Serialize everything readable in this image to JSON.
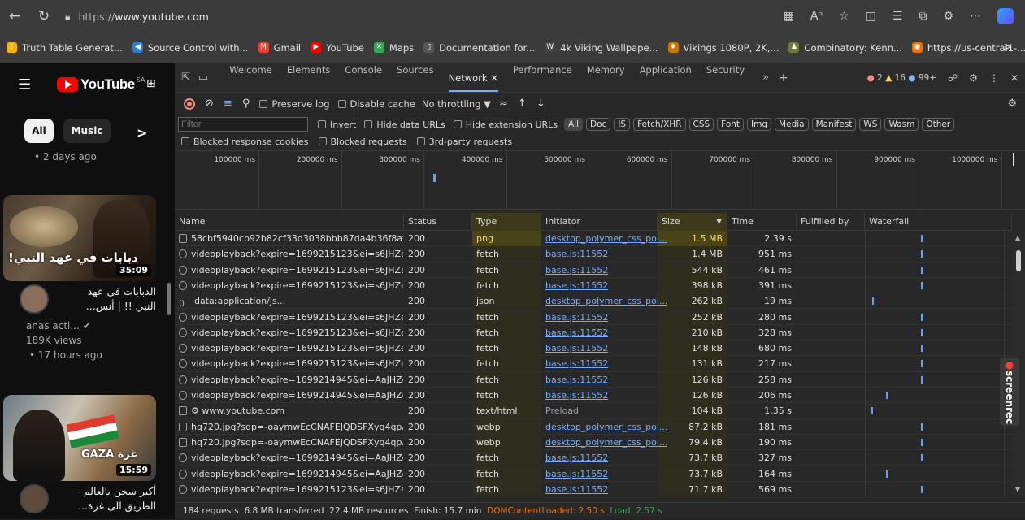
{
  "browser": {
    "url_prefix": "https://",
    "url_host": "www.youtube.com",
    "bookmarks": [
      {
        "label": "Truth Table Generat...",
        "color": "#f4b400",
        "glyph": "!"
      },
      {
        "label": "Source Control with...",
        "color": "#2f7cd6",
        "glyph": "◀"
      },
      {
        "label": "Gmail",
        "color": "#ea4335",
        "glyph": "M"
      },
      {
        "label": "YouTube",
        "color": "#ff0000",
        "glyph": "▶"
      },
      {
        "label": "Maps",
        "color": "#34a853",
        "glyph": "✕"
      },
      {
        "label": "Documentation for...",
        "color": "#555555",
        "glyph": "▯"
      },
      {
        "label": "4k Viking Wallpape...",
        "color": "#444444",
        "glyph": "W"
      },
      {
        "label": "Vikings 1080P, 2K,...",
        "color": "#c77700",
        "glyph": "♦"
      },
      {
        "label": "Combinatory: Kenn...",
        "color": "#6b7b3a",
        "glyph": "♟"
      },
      {
        "label": "https://us-central1-...",
        "color": "#e8710a",
        "glyph": "◉"
      }
    ],
    "bookmarks_more": ">"
  },
  "youtube": {
    "logo": "YouTube",
    "region": "SA",
    "chips": {
      "all": "All",
      "music": "Music",
      "next": ">"
    },
    "meta_top": "• 2 days ago",
    "video1": {
      "duration": "35:09",
      "title_line1": "الدبابات في عهد",
      "title_line2": "النبي !! | أنس...",
      "channel": "anas acti...",
      "views": "189K views",
      "age": "• 17 hours ago",
      "thumb_text": "دبابات في عهد النبي!"
    },
    "video2": {
      "duration": "15:59",
      "title_line1": "أكبر سجن بالعالم -",
      "title_line2": "الطريق الى غزة...",
      "thumb_text": "GAZA غزة"
    }
  },
  "devtools": {
    "tabs": [
      "Welcome",
      "Elements",
      "Console",
      "Sources",
      "Network",
      "Performance",
      "Memory",
      "Application",
      "Security"
    ],
    "active_tab": "Network",
    "badges": {
      "errors": "2",
      "warnings": "16",
      "info": "99+"
    },
    "toolbar": {
      "preserve_log": "Preserve log",
      "disable_cache": "Disable cache",
      "throttling": "No throttling"
    },
    "filter": {
      "placeholder": "Filter",
      "invert": "Invert",
      "hide_data_urls": "Hide data URLs",
      "hide_extension_urls": "Hide extension URLs",
      "types": [
        "All",
        "Doc",
        "JS",
        "Fetch/XHR",
        "CSS",
        "Font",
        "Img",
        "Media",
        "Manifest",
        "WS",
        "Wasm",
        "Other"
      ],
      "blocked_cookies": "Blocked response cookies",
      "blocked_requests": "Blocked requests",
      "third_party": "3rd-party requests"
    },
    "timeline_ticks": [
      "100000 ms",
      "200000 ms",
      "300000 ms",
      "400000 ms",
      "500000 ms",
      "600000 ms",
      "700000 ms",
      "800000 ms",
      "900000 ms",
      "1000000 ms"
    ],
    "columns": {
      "name": "Name",
      "status": "Status",
      "type": "Type",
      "initiator": "Initiator",
      "size": "Size",
      "time": "Time",
      "fulfilled": "Fulfilled by",
      "waterfall": "Waterfall"
    },
    "rows": [
      {
        "name": "58cbf5940cb92b82cf33d3038bbb87da4b36f8af52c...",
        "status": "200",
        "type": "png",
        "initiator": "desktop_polymer_css_pol...",
        "init_link": true,
        "size": "1.5 MB",
        "time": "2.39 s",
        "icon": "doc",
        "wf": 0.38
      },
      {
        "name": "videoplayback?expire=1699215123&ei=s6JHZe-AB...",
        "status": "200",
        "type": "fetch",
        "initiator": "base.js:11552",
        "init_link": true,
        "size": "1.4 MB",
        "time": "951 ms",
        "icon": "fetch",
        "wf": 0.38
      },
      {
        "name": "videoplayback?expire=1699215123&ei=s6JHZe-AB...",
        "status": "200",
        "type": "fetch",
        "initiator": "base.js:11552",
        "init_link": true,
        "size": "544 kB",
        "time": "461 ms",
        "icon": "fetch",
        "wf": 0.38
      },
      {
        "name": "videoplayback?expire=1699215123&ei=s6JHZe-AB...",
        "status": "200",
        "type": "fetch",
        "initiator": "base.js:11552",
        "init_link": true,
        "size": "398 kB",
        "time": "391 ms",
        "icon": "fetch",
        "wf": 0.38
      },
      {
        "name": "data:application/js...",
        "status": "200",
        "type": "json",
        "initiator": "desktop_polymer_css_pol...",
        "init_link": true,
        "size": "262 kB",
        "time": "19 ms",
        "icon": "data",
        "wf": 0.02
      },
      {
        "name": "videoplayback?expire=1699215123&ei=s6JHZe-AB...",
        "status": "200",
        "type": "fetch",
        "initiator": "base.js:11552",
        "init_link": true,
        "size": "252 kB",
        "time": "280 ms",
        "icon": "fetch",
        "wf": 0.38
      },
      {
        "name": "videoplayback?expire=1699215123&ei=s6JHZe-AB...",
        "status": "200",
        "type": "fetch",
        "initiator": "base.js:11552",
        "init_link": true,
        "size": "210 kB",
        "time": "328 ms",
        "icon": "fetch",
        "wf": 0.38
      },
      {
        "name": "videoplayback?expire=1699215123&ei=s6JHZe-AB...",
        "status": "200",
        "type": "fetch",
        "initiator": "base.js:11552",
        "init_link": true,
        "size": "148 kB",
        "time": "680 ms",
        "icon": "fetch",
        "wf": 0.38
      },
      {
        "name": "videoplayback?expire=1699215123&ei=s6JHZe-AB...",
        "status": "200",
        "type": "fetch",
        "initiator": "base.js:11552",
        "init_link": true,
        "size": "131 kB",
        "time": "217 ms",
        "icon": "fetch",
        "wf": 0.38
      },
      {
        "name": "videoplayback?expire=1699214945&ei=AaJHZe-5I...",
        "status": "200",
        "type": "fetch",
        "initiator": "base.js:11552",
        "init_link": true,
        "size": "126 kB",
        "time": "258 ms",
        "icon": "fetch",
        "wf": 0.38
      },
      {
        "name": "videoplayback?expire=1699214945&ei=AaJHZe-5I...",
        "status": "200",
        "type": "fetch",
        "initiator": "base.js:11552",
        "init_link": true,
        "size": "126 kB",
        "time": "206 ms",
        "icon": "fetch",
        "wf": 0.12
      },
      {
        "name": "⚙ www.youtube.com",
        "status": "200",
        "type": "text/html",
        "initiator": "Preload",
        "init_link": false,
        "size": "104 kB",
        "time": "1.35 s",
        "icon": "doc",
        "wf": 0.01
      },
      {
        "name": "hq720.jpg?sqp=-oaymwEcCNAFEJQDSFXyq4qpAw4...",
        "status": "200",
        "type": "webp",
        "initiator": "desktop_polymer_css_pol...",
        "init_link": true,
        "size": "87.2 kB",
        "time": "181 ms",
        "icon": "doc",
        "wf": 0.38
      },
      {
        "name": "hq720.jpg?sqp=-oaymwEcCNAFEJQDSFXyq4qpAw4...",
        "status": "200",
        "type": "webp",
        "initiator": "desktop_polymer_css_pol...",
        "init_link": true,
        "size": "79.4 kB",
        "time": "190 ms",
        "icon": "doc",
        "wf": 0.38
      },
      {
        "name": "videoplayback?expire=1699214945&ei=AaJHZe-5I...",
        "status": "200",
        "type": "fetch",
        "initiator": "base.js:11552",
        "init_link": true,
        "size": "73.7 kB",
        "time": "327 ms",
        "icon": "fetch",
        "wf": 0.38
      },
      {
        "name": "videoplayback?expire=1699214945&ei=AaJHZe-5I...",
        "status": "200",
        "type": "fetch",
        "initiator": "base.js:11552",
        "init_link": true,
        "size": "73.7 kB",
        "time": "164 ms",
        "icon": "fetch",
        "wf": 0.12
      },
      {
        "name": "videoplayback?expire=1699215123&ei=s6JHZe-AB...",
        "status": "200",
        "type": "fetch",
        "initiator": "base.js:11552",
        "init_link": true,
        "size": "71.7 kB",
        "time": "569 ms",
        "icon": "fetch",
        "wf": 0.38
      }
    ],
    "status": {
      "requests": "184 requests",
      "transferred": "6.8 MB transferred",
      "resources": "22.4 MB resources",
      "finish": "Finish: 15.7 min",
      "dcl": "DOMContentLoaded: 2.50 s",
      "load": "Load: 2.57 s"
    },
    "colors": {
      "dcl": "#e8710a",
      "load": "#34a853",
      "link": "#7cacf8",
      "sort_highlight": "#3d3a1a"
    }
  },
  "overlay": {
    "screenrec": "screenrec"
  }
}
